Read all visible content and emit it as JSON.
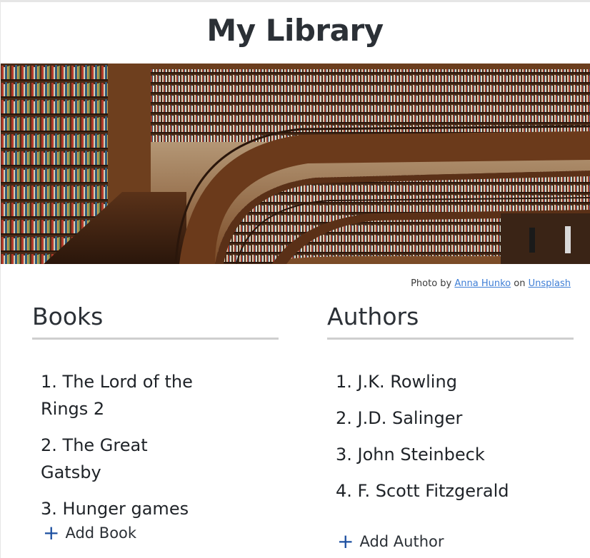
{
  "page": {
    "title": "My Library"
  },
  "hero": {
    "alt": "Library bookshelves"
  },
  "credit": {
    "prefix": "Photo by",
    "author": "Anna Hunko",
    "middle": "on",
    "site": "Unsplash"
  },
  "books": {
    "heading": "Books",
    "items": [
      "1. The Lord of the Rings 2",
      "2. The Great Gatsby",
      "3. Hunger games"
    ],
    "add_label": "Add Book"
  },
  "authors": {
    "heading": "Authors",
    "items": [
      "1. J.K. Rowling",
      "2. J.D. Salinger",
      "3. John Steinbeck",
      "4. F. Scott Fitzgerald"
    ],
    "add_label": "Add Author"
  },
  "icons": {
    "add": "plus-icon"
  },
  "colors": {
    "accent": "#1c4fa0",
    "link": "#3f7fd6",
    "divider": "#cfcfcf",
    "text": "#2b3036"
  }
}
